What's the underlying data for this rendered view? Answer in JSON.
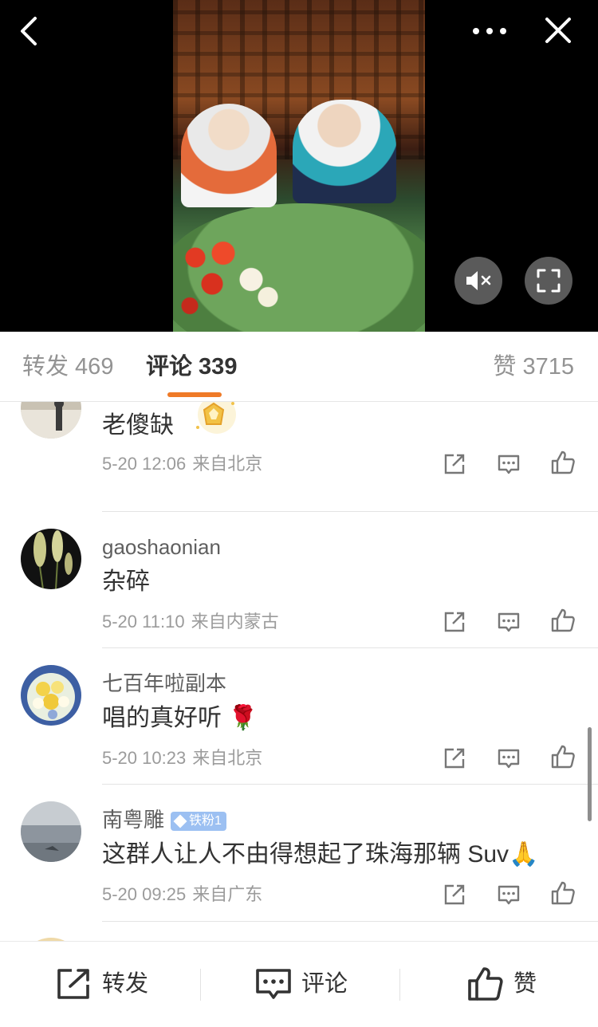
{
  "video": {
    "back_icon": "chevron-left-icon",
    "more_icon": "more-dots-icon",
    "close_icon": "close-icon",
    "mute_icon": "speaker-muted-icon",
    "fullscreen_icon": "fullscreen-icon"
  },
  "tabs": {
    "repost": "转发 469",
    "comments": "评论 339",
    "likes": "赞 3715",
    "active": "comments",
    "accent_color": "#ef7a27"
  },
  "comments": [
    {
      "username": "",
      "text": "老傻缺",
      "time": "5-20 12:06",
      "location": "来自北京",
      "has_medal": true
    },
    {
      "username": "gaoshaonian",
      "text": "杂碎",
      "time": "5-20 11:10",
      "location": "来自内蒙古"
    },
    {
      "username": "七百年啦副本",
      "text": "唱的真好听 🌹",
      "time": "5-20 10:23",
      "location": "来自北京"
    },
    {
      "username": "南粤雕",
      "badge": "铁粉1",
      "text": "这群人让人不由得想起了珠海那辆 Suv🙏",
      "time": "5-20 09:25",
      "location": "来自广东"
    }
  ],
  "bottom_bar": {
    "repost_label": "转发",
    "comment_label": "评论",
    "like_label": "赞"
  }
}
